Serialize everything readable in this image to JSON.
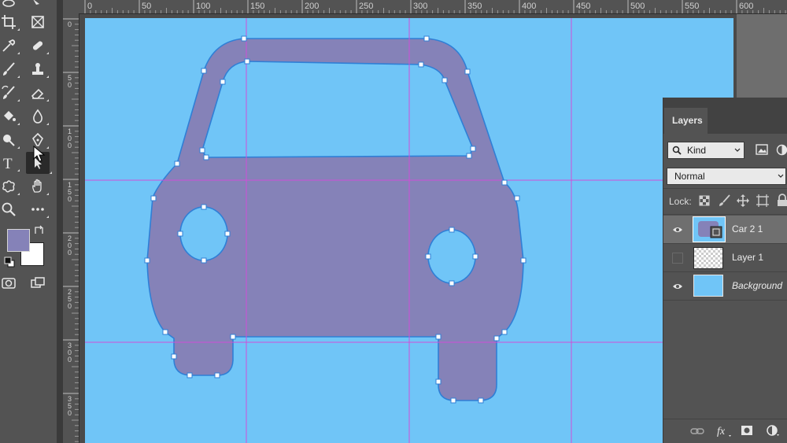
{
  "ruler_top": {
    "labels": [
      "0",
      "50",
      "100",
      "150",
      "200",
      "250",
      "300",
      "350",
      "400",
      "450",
      "500",
      "550",
      "600"
    ]
  },
  "ruler_left": {
    "labels": [
      "0",
      "5 0",
      "1 0 0",
      "1 5 0",
      "2 0 0",
      "2 5 0",
      "3 0 0",
      "3 5 0"
    ]
  },
  "colors": {
    "canvas": "#70c5f7",
    "car_fill": "#8582b8",
    "path_stroke": "#2f7fd6",
    "guide": "#cf4fd9",
    "foreground": "#8582b8",
    "background": "#ffffff"
  },
  "tools": [
    {
      "name": "lasso-tool-icon"
    },
    {
      "name": "object-select-tool-icon"
    },
    {
      "name": "crop-tool-icon"
    },
    {
      "name": "frame-tool-icon"
    },
    {
      "name": "eyedropper-tool-icon"
    },
    {
      "name": "healing-brush-tool-icon"
    },
    {
      "name": "brush-tool-icon"
    },
    {
      "name": "clone-stamp-tool-icon"
    },
    {
      "name": "history-brush-tool-icon"
    },
    {
      "name": "eraser-tool-icon"
    },
    {
      "name": "paint-bucket-tool-icon"
    },
    {
      "name": "blur-tool-icon"
    },
    {
      "name": "dodge-tool-icon"
    },
    {
      "name": "pen-tool-icon"
    },
    {
      "name": "type-tool-icon"
    },
    {
      "name": "direct-selection-tool-icon"
    },
    {
      "name": "custom-shape-tool-icon"
    },
    {
      "name": "hand-tool-icon"
    },
    {
      "name": "zoom-tool-icon"
    },
    {
      "name": "more-tools-icon"
    }
  ],
  "layers_panel": {
    "tab_label": "Layers",
    "filter_label": "Kind",
    "blend_mode": "Normal",
    "lock_label": "Lock:",
    "layers": [
      {
        "name": "Car 2 1",
        "visible": true,
        "selected": true
      },
      {
        "name": "Layer 1",
        "visible": false,
        "selected": false
      },
      {
        "name": "Background",
        "visible": true,
        "selected": false
      }
    ]
  }
}
